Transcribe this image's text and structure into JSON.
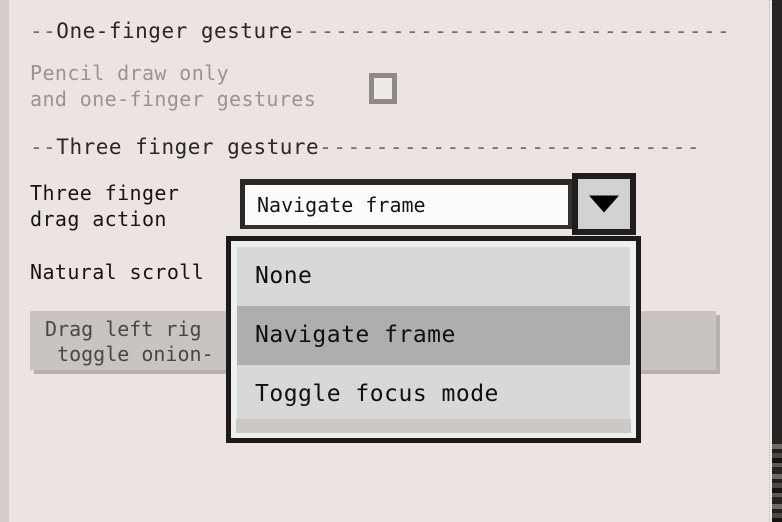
{
  "sections": {
    "one_finger": {
      "lead": "--",
      "title": "One-finger gesture",
      "rule": "-------------------------------"
    },
    "three_finger": {
      "lead": "--",
      "title": "Three finger gesture",
      "rule": "---------------------------"
    }
  },
  "controls": {
    "pencil_draw": {
      "label": "Pencil draw only\nand one-finger gestures",
      "checked": false
    },
    "three_finger_drag": {
      "label": "Three finger\ndrag action",
      "value": "Navigate frame",
      "dropdown_icon": "chevron-down-icon",
      "options": [
        {
          "label": "None",
          "selected": false
        },
        {
          "label": "Navigate frame",
          "selected": true
        },
        {
          "label": "Toggle focus mode",
          "selected": false
        }
      ]
    },
    "natural_scroll": {
      "label": "Natural scroll"
    }
  },
  "hint": {
    "text": "Drag left rig                    n to\n toggle onion-"
  }
}
